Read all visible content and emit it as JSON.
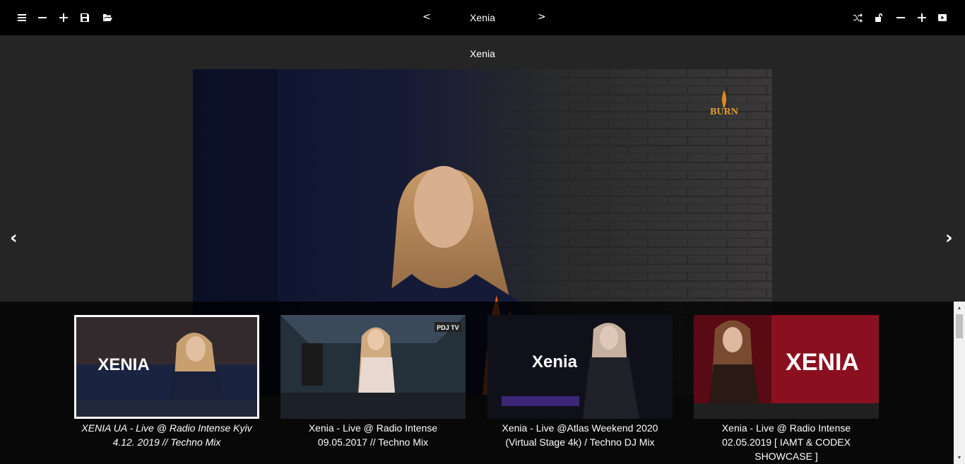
{
  "toolbar": {
    "left_icons": [
      "menu-icon",
      "minus-icon",
      "plus-icon",
      "save-icon",
      "folder-open-icon"
    ],
    "prev_label": "<",
    "title": "Xenia",
    "next_label": ">",
    "right_icons": [
      "shuffle-icon",
      "unlock-icon",
      "minus-icon",
      "plus-icon",
      "youtube-icon"
    ]
  },
  "video": {
    "title": "Xenia",
    "logo_text": "BURN"
  },
  "side_nav": {
    "prev": "‹",
    "next": "›"
  },
  "thumbnails": [
    {
      "caption": "XENIA UA - Live @ Radio Intense Kyiv 4.12. 2019 // Techno Mix",
      "overlay": "XENIA",
      "selected": true
    },
    {
      "caption": "Xenia - Live @ Radio Intense 09.05.2017 // Techno Mix",
      "overlay": "PDJ TV",
      "selected": false
    },
    {
      "caption": "Xenia - Live @Atlas Weekend 2020 (Virtual Stage 4k) / Techno DJ Mix",
      "overlay": "Xenia",
      "selected": false
    },
    {
      "caption": "Xenia - Live @ Radio Intense 02.05.2019 [ IAMT & CODEX SHOWCASE ]",
      "overlay": "XENIA",
      "selected": false
    }
  ]
}
